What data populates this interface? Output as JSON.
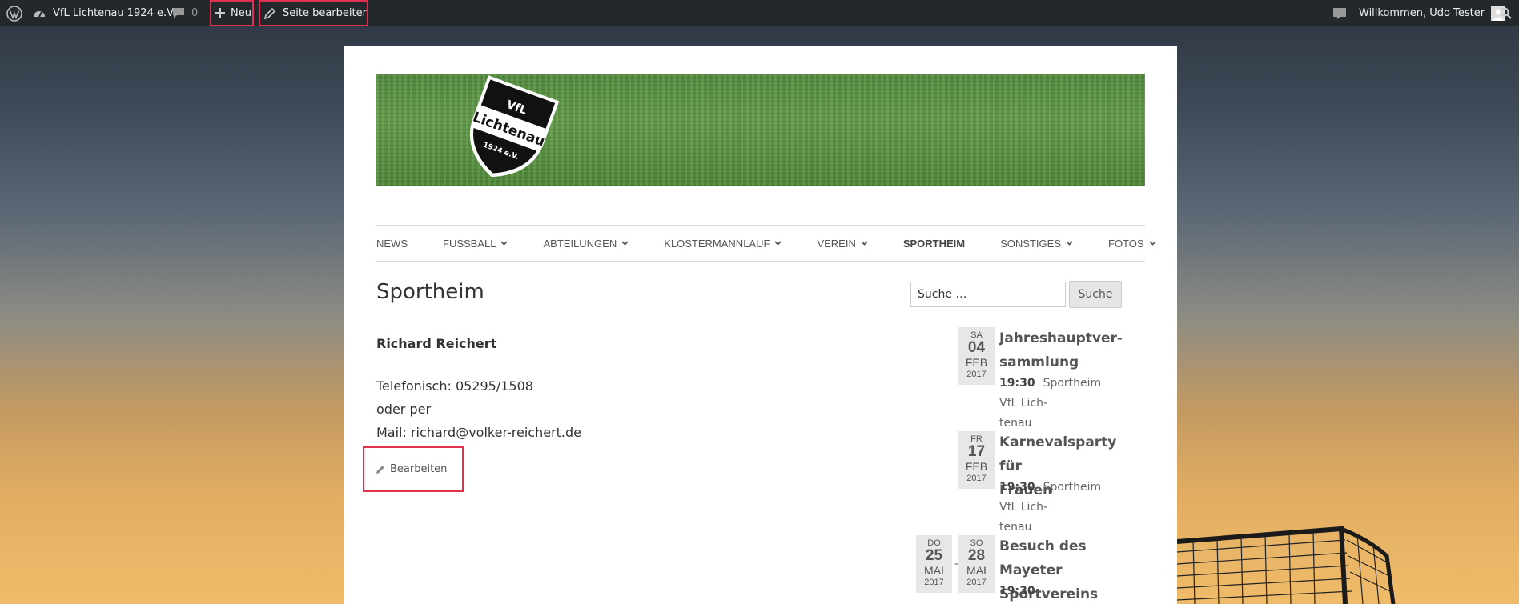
{
  "adminbar": {
    "site_name": "VfL Lichtenau 1924 e.V.",
    "comments_count": "0",
    "new_label": "Neu",
    "edit_page_label": "Seite bearbeiten",
    "welcome": "Willkommen, Udo Tester"
  },
  "header": {
    "crest_text_top": "VfL",
    "crest_text_main": "Lichtenau",
    "crest_text_year": "1924 e.V."
  },
  "nav": {
    "items": [
      {
        "label": "NEWS",
        "has_children": false
      },
      {
        "label": "FUSSBALL",
        "has_children": true
      },
      {
        "label": "ABTEILUNGEN",
        "has_children": true
      },
      {
        "label": "KLOSTERMANNLAUF",
        "has_children": true
      },
      {
        "label": "VEREIN",
        "has_children": true
      },
      {
        "label": "SPORTHEIM",
        "has_children": false
      },
      {
        "label": "SONSTIGES",
        "has_children": true
      },
      {
        "label": "FOTOS",
        "has_children": true
      }
    ]
  },
  "page": {
    "title": "Sportheim",
    "contact_name": "Richard Reichert",
    "line_phone": "Telefonisch: 05295/1508",
    "line_or": "oder per",
    "line_mail": "Mail: richard@volker-reichert.de",
    "edit_label": "Bearbeiten"
  },
  "sidebar": {
    "search_placeholder": "Suche …",
    "search_button": "Suche",
    "events": [
      {
        "dow": "SA",
        "day": "04",
        "mon": "FEB",
        "yr": "2017",
        "title1": "Jahreshauptver-",
        "title2": "sammlung",
        "time": "19:30",
        "loc1": "Sportheim VfL Lich-",
        "loc2": "tenau"
      },
      {
        "dow": "FR",
        "day": "17",
        "mon": "FEB",
        "yr": "2017",
        "title1": "Karnevalsparty für",
        "title2": "Frauen",
        "time": "19:30",
        "loc1": "Sportheim VfL Lich-",
        "loc2": "tenau"
      },
      {
        "dow": "DO",
        "day": "25",
        "mon": "MAI",
        "yr": "2017",
        "dow2": "SO",
        "day2": "28",
        "mon2": "MAI",
        "yr2": "2017",
        "title1": "Besuch des Mayeter",
        "title2": "Sportvereins",
        "time": "19:30"
      }
    ]
  }
}
